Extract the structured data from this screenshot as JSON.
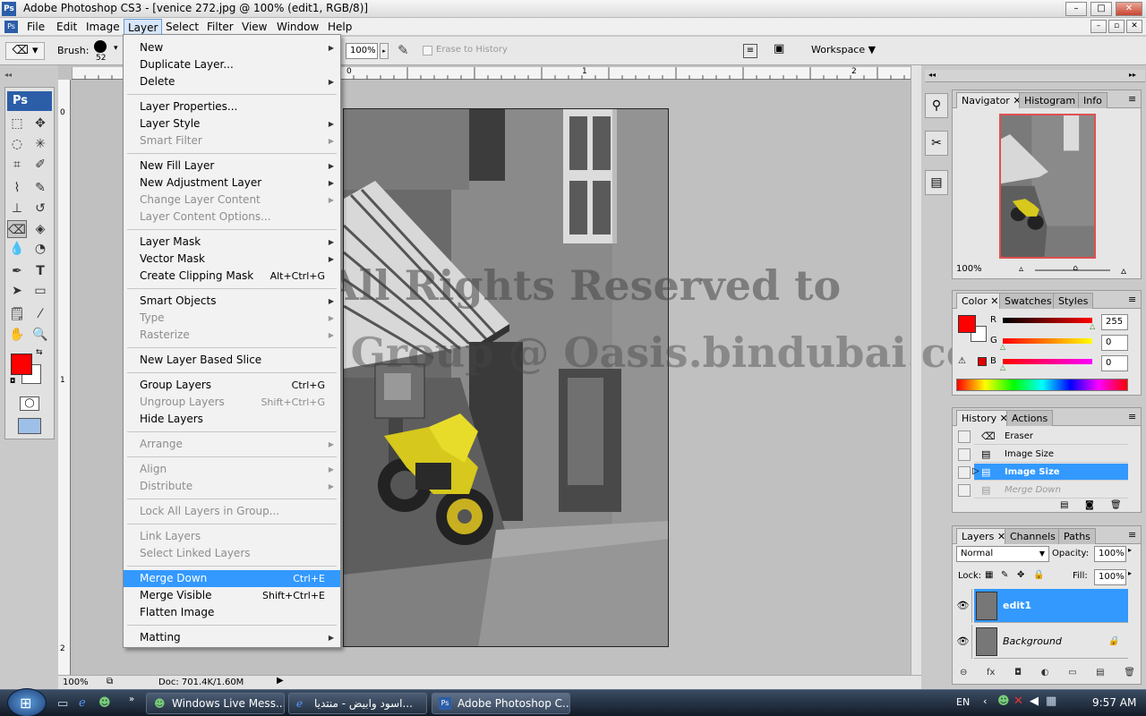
{
  "window": {
    "title": "Adobe Photoshop CS3 - [venice 272.jpg @ 100% (edit1, RGB/8)]"
  },
  "menubar": [
    "File",
    "Edit",
    "Image",
    "Layer",
    "Select",
    "Filter",
    "View",
    "Window",
    "Help"
  ],
  "options_bar": {
    "brush_label": "Brush:",
    "brush_size": "52",
    "opacity": "100%",
    "erase_history": "Erase to History",
    "workspace": "Workspace"
  },
  "layer_menu": [
    {
      "label": "New",
      "arrow": true
    },
    {
      "label": "Duplicate Layer..."
    },
    {
      "label": "Delete",
      "arrow": true
    },
    {
      "sep": true
    },
    {
      "label": "Layer Properties..."
    },
    {
      "label": "Layer Style",
      "arrow": true
    },
    {
      "label": "Smart Filter",
      "arrow": true,
      "disabled": true
    },
    {
      "sep": true
    },
    {
      "label": "New Fill Layer",
      "arrow": true
    },
    {
      "label": "New Adjustment Layer",
      "arrow": true
    },
    {
      "label": "Change Layer Content",
      "arrow": true,
      "disabled": true
    },
    {
      "label": "Layer Content Options...",
      "disabled": true
    },
    {
      "sep": true
    },
    {
      "label": "Layer Mask",
      "arrow": true
    },
    {
      "label": "Vector Mask",
      "arrow": true
    },
    {
      "label": "Create Clipping Mask",
      "shortcut": "Alt+Ctrl+G"
    },
    {
      "sep": true
    },
    {
      "label": "Smart Objects",
      "arrow": true
    },
    {
      "label": "Type",
      "arrow": true,
      "disabled": true
    },
    {
      "label": "Rasterize",
      "arrow": true,
      "disabled": true
    },
    {
      "sep": true
    },
    {
      "label": "New Layer Based Slice"
    },
    {
      "sep": true
    },
    {
      "label": "Group Layers",
      "shortcut": "Ctrl+G"
    },
    {
      "label": "Ungroup Layers",
      "shortcut": "Shift+Ctrl+G",
      "disabled": true
    },
    {
      "label": "Hide Layers"
    },
    {
      "sep": true
    },
    {
      "label": "Arrange",
      "arrow": true,
      "disabled": true
    },
    {
      "sep": true
    },
    {
      "label": "Align",
      "arrow": true,
      "disabled": true
    },
    {
      "label": "Distribute",
      "arrow": true,
      "disabled": true
    },
    {
      "sep": true
    },
    {
      "label": "Lock All Layers in Group...",
      "disabled": true
    },
    {
      "sep": true
    },
    {
      "label": "Link Layers",
      "disabled": true
    },
    {
      "label": "Select Linked Layers",
      "disabled": true
    },
    {
      "sep": true
    },
    {
      "label": "Merge Down",
      "shortcut": "Ctrl+E",
      "highlighted": true
    },
    {
      "label": "Merge Visible",
      "shortcut": "Shift+Ctrl+E"
    },
    {
      "label": "Flatten Image"
    },
    {
      "sep": true
    },
    {
      "label": "Matting",
      "arrow": true
    }
  ],
  "document": {
    "watermark_line1": "All Rights Reserved to",
    "watermark_line2": "Colors Group @ Oasis.bindubai.com",
    "ruler_top": [
      "0",
      "1",
      "2"
    ],
    "ruler_left": [
      "0",
      "1",
      "2"
    ],
    "zoom": "100%",
    "doc_info": "Doc: 701.4K/1.60M"
  },
  "navigator": {
    "tabs": [
      "Navigator",
      "Histogram",
      "Info"
    ],
    "zoom": "100%",
    "zoom_level": 0.55
  },
  "color": {
    "tabs": [
      "Color",
      "Swatches",
      "Styles"
    ],
    "r": "255",
    "g": "0",
    "b": "0",
    "foreground": "#ff0000",
    "background": "#ffffff"
  },
  "history": {
    "tabs": [
      "History",
      "Actions"
    ],
    "items": [
      {
        "label": "Eraser"
      },
      {
        "label": "Image Size"
      },
      {
        "label": "Image Size",
        "active": true
      },
      {
        "label": "Merge Down",
        "dimmed": true
      }
    ]
  },
  "layers": {
    "tabs": [
      "Layers",
      "Channels",
      "Paths"
    ],
    "blend_mode": "Normal",
    "opacity_label": "Opacity:",
    "opacity": "100%",
    "lock_label": "Lock:",
    "fill_label": "Fill:",
    "fill": "100%",
    "items": [
      {
        "name": "edit1",
        "selected": true
      },
      {
        "name": "Background",
        "locked": true
      }
    ]
  },
  "taskbar": {
    "buttons": [
      "Windows Live Mess...",
      "اسود وابيض - منتديا...",
      "Adobe Photoshop C..."
    ],
    "lang": "EN",
    "time": "9:57 AM"
  }
}
